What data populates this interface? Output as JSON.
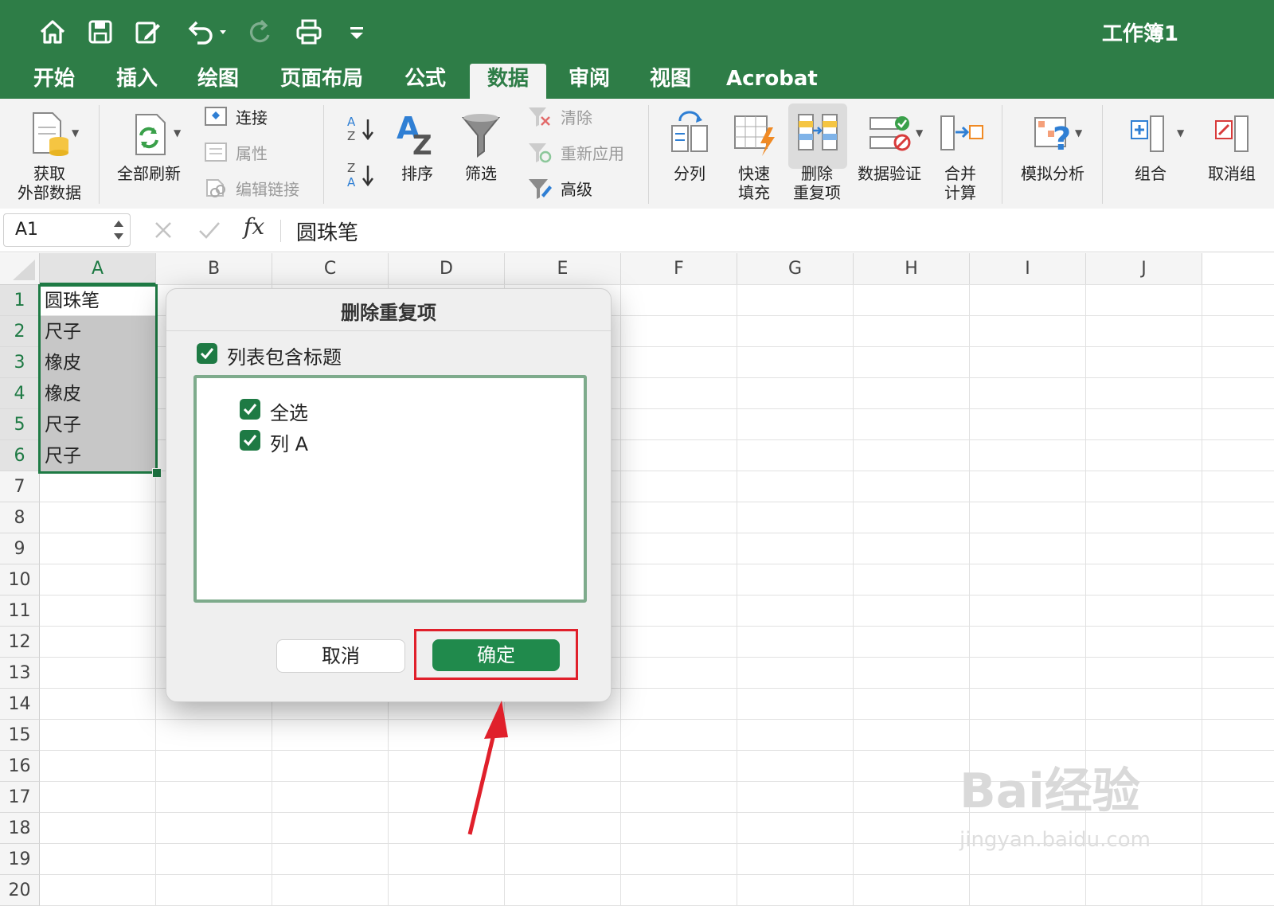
{
  "window": {
    "title": "工作簿1"
  },
  "quick_access": [
    {
      "name": "home-icon"
    },
    {
      "name": "save-icon"
    },
    {
      "name": "edit-icon"
    },
    {
      "name": "undo-icon"
    },
    {
      "name": "redo-icon"
    },
    {
      "name": "print-icon"
    },
    {
      "name": "customize-icon"
    }
  ],
  "tabs": [
    "开始",
    "插入",
    "绘图",
    "页面布局",
    "公式",
    "数据",
    "审阅",
    "视图",
    "Acrobat"
  ],
  "active_tab": "数据",
  "ribbon": {
    "get_external_line1": "获取",
    "get_external_line2": "外部数据",
    "refresh_all": "全部刷新",
    "connections": "连接",
    "properties": "属性",
    "edit_links": "编辑链接",
    "sort": "排序",
    "filter": "筛选",
    "clear": "清除",
    "reapply": "重新应用",
    "advanced": "高级",
    "text_to_columns": "分列",
    "flash_fill_line1": "快速",
    "flash_fill_line2": "填充",
    "remove_dup_line1": "删除",
    "remove_dup_line2": "重复项",
    "data_validation": "数据验证",
    "consolidate_line1": "合并",
    "consolidate_line2": "计算",
    "what_if": "模拟分析",
    "group": "组合",
    "ungroup": "取消组"
  },
  "formula_bar": {
    "cell_ref": "A1",
    "formula": "圆珠笔",
    "fx": "fx"
  },
  "columns": [
    "A",
    "B",
    "C",
    "D",
    "E",
    "F",
    "G",
    "H",
    "I",
    "J"
  ],
  "rows": [
    "1",
    "2",
    "3",
    "4",
    "5",
    "6",
    "7",
    "8",
    "9",
    "10",
    "11",
    "12",
    "13",
    "14",
    "15",
    "16",
    "17",
    "18",
    "19",
    "20"
  ],
  "cells_a": [
    "圆珠笔",
    "尺子",
    "橡皮",
    "橡皮",
    "尺子",
    "尺子"
  ],
  "dialog": {
    "title": "删除重复项",
    "header_checkbox": "列表包含标题",
    "select_all": "全选",
    "column_a": "列 A",
    "cancel": "取消",
    "ok": "确定"
  },
  "watermark": {
    "brand": "Bai经验",
    "url": "jingyan.baidu.com"
  },
  "colors": {
    "accent": "#2e7d47",
    "highlight": "#e0202b",
    "ok_button": "#208a4c"
  }
}
